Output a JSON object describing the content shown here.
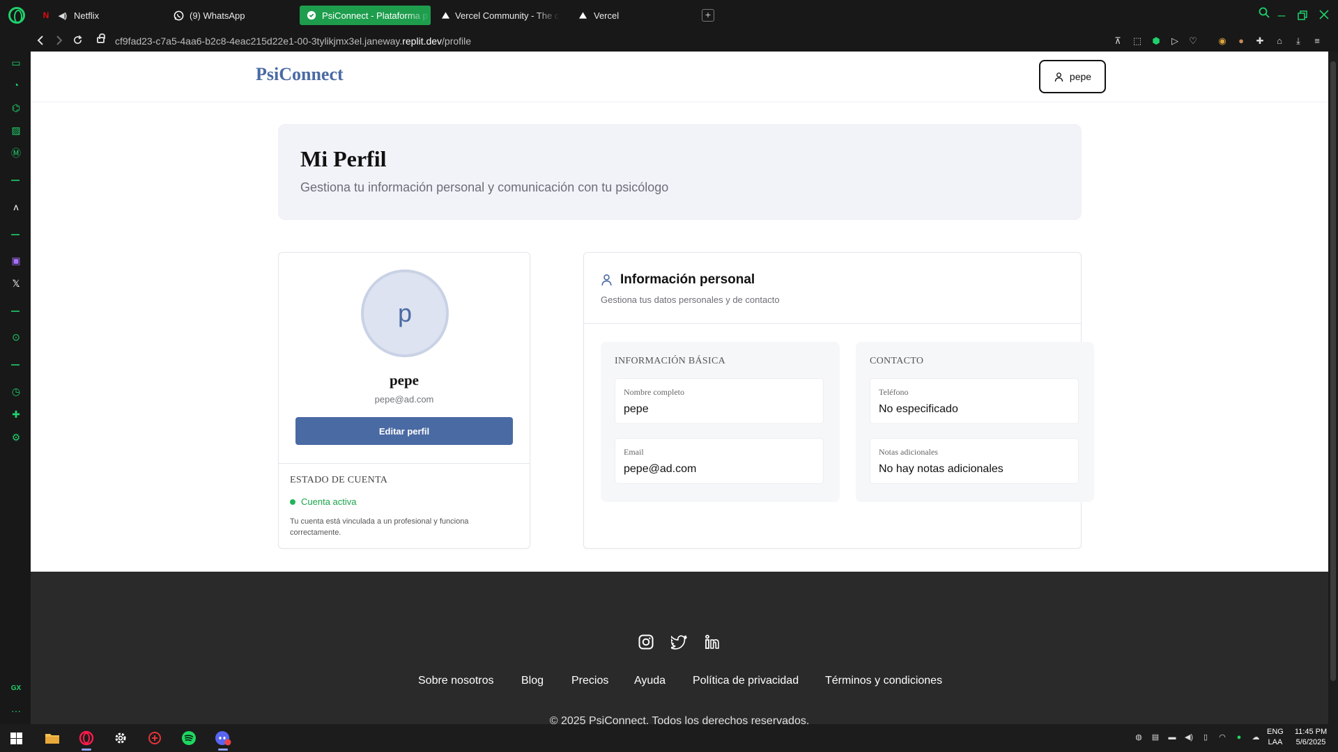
{
  "browser": {
    "tabs": [
      {
        "label": "Netflix",
        "icon": "netflix-icon"
      },
      {
        "label": "(9) WhatsApp",
        "icon": "whatsapp-icon"
      },
      {
        "label": "PsiConnect - Plataforma p",
        "icon": "replit-icon"
      },
      {
        "label": "Vercel Community - The c",
        "icon": "vercel-icon"
      },
      {
        "label": "Vercel",
        "icon": "vercel-icon"
      }
    ],
    "url_prefix": "cf9fad23-c7a5-4aa6-b2c8-4eac215d22e1-00-3tylikjmx3el.janeway.",
    "url_domain": "replit.dev",
    "url_path": "/profile"
  },
  "header": {
    "brand": "PsiConnect",
    "user_button": "pepe"
  },
  "hero": {
    "title": "Mi Perfil",
    "subtitle": "Gestiona tu información personal y comunicación con tu psicólogo"
  },
  "profile": {
    "avatar_letter": "p",
    "name": "pepe",
    "email": "pepe@ad.com",
    "edit_button": "Editar perfil",
    "status_title": "ESTADO DE CUENTA",
    "status": "Cuenta activa",
    "status_note": "Tu cuenta está vinculada a un profesional y funciona correctamente.",
    "status_color": "#22b45a"
  },
  "info": {
    "title": "Información personal",
    "subtitle": "Gestiona tus datos personales y de contacto",
    "basic": {
      "title": "INFORMACIÓN BÁSICA",
      "fields": [
        {
          "label": "Nombre completo",
          "value": "pepe"
        },
        {
          "label": "Email",
          "value": "pepe@ad.com"
        }
      ]
    },
    "contact": {
      "title": "CONTACTO",
      "fields": [
        {
          "label": "Teléfono",
          "value": "No especificado"
        },
        {
          "label": "Notas adicionales",
          "value": "No hay notas adicionales"
        }
      ]
    }
  },
  "footer": {
    "social": [
      "instagram-icon",
      "twitter-icon",
      "linkedin-icon"
    ],
    "links": [
      "Sobre nosotros",
      "Blog",
      "Precios",
      "Ayuda",
      "Política de privacidad",
      "Términos y condiciones"
    ],
    "copyright": "© 2025 PsiConnect. Todos los derechos reservados."
  },
  "taskbar": {
    "lang_1": "ENG",
    "lang_2": "LAA",
    "time": "11:45 PM",
    "date": "5/6/2025"
  },
  "colors": {
    "brand": "#4a6aa3",
    "opera_accent": "#1fd16c",
    "active_tab": "#1e9e4d",
    "footer_bg": "#2a2a2a"
  }
}
